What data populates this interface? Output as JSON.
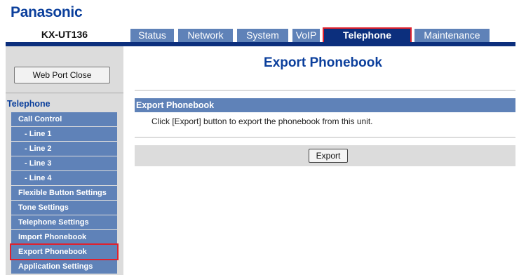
{
  "brand": {
    "logo_text": "Panasonic"
  },
  "device": {
    "model": "KX-UT136"
  },
  "tabs": [
    {
      "label": "Status"
    },
    {
      "label": "Network"
    },
    {
      "label": "System"
    },
    {
      "label": "VoIP"
    },
    {
      "label": "Telephone",
      "active": true
    },
    {
      "label": "Maintenance"
    }
  ],
  "sidebar": {
    "web_port_close_label": "Web Port Close",
    "category": "Telephone",
    "items": [
      {
        "label": "Call Control"
      },
      {
        "label": "- Line 1"
      },
      {
        "label": "- Line 2"
      },
      {
        "label": "- Line 3"
      },
      {
        "label": "- Line 4"
      },
      {
        "label": "Flexible Button Settings"
      },
      {
        "label": "Tone Settings"
      },
      {
        "label": "Telephone Settings"
      },
      {
        "label": "Import Phonebook"
      },
      {
        "label": "Export Phonebook",
        "selected": true
      },
      {
        "label": "Application Settings"
      }
    ]
  },
  "main": {
    "title": "Export Phonebook",
    "section_title": "Export Phonebook",
    "description": "Click [Export] button to export the phonebook from this unit.",
    "export_button_label": "Export"
  },
  "colors": {
    "brand_blue": "#0b3f9c",
    "tab_blue": "#5f82b8",
    "active_tab_navy": "#0c2f7d",
    "highlight_red": "#e0212d",
    "panel_gray": "#dcdcdc"
  }
}
